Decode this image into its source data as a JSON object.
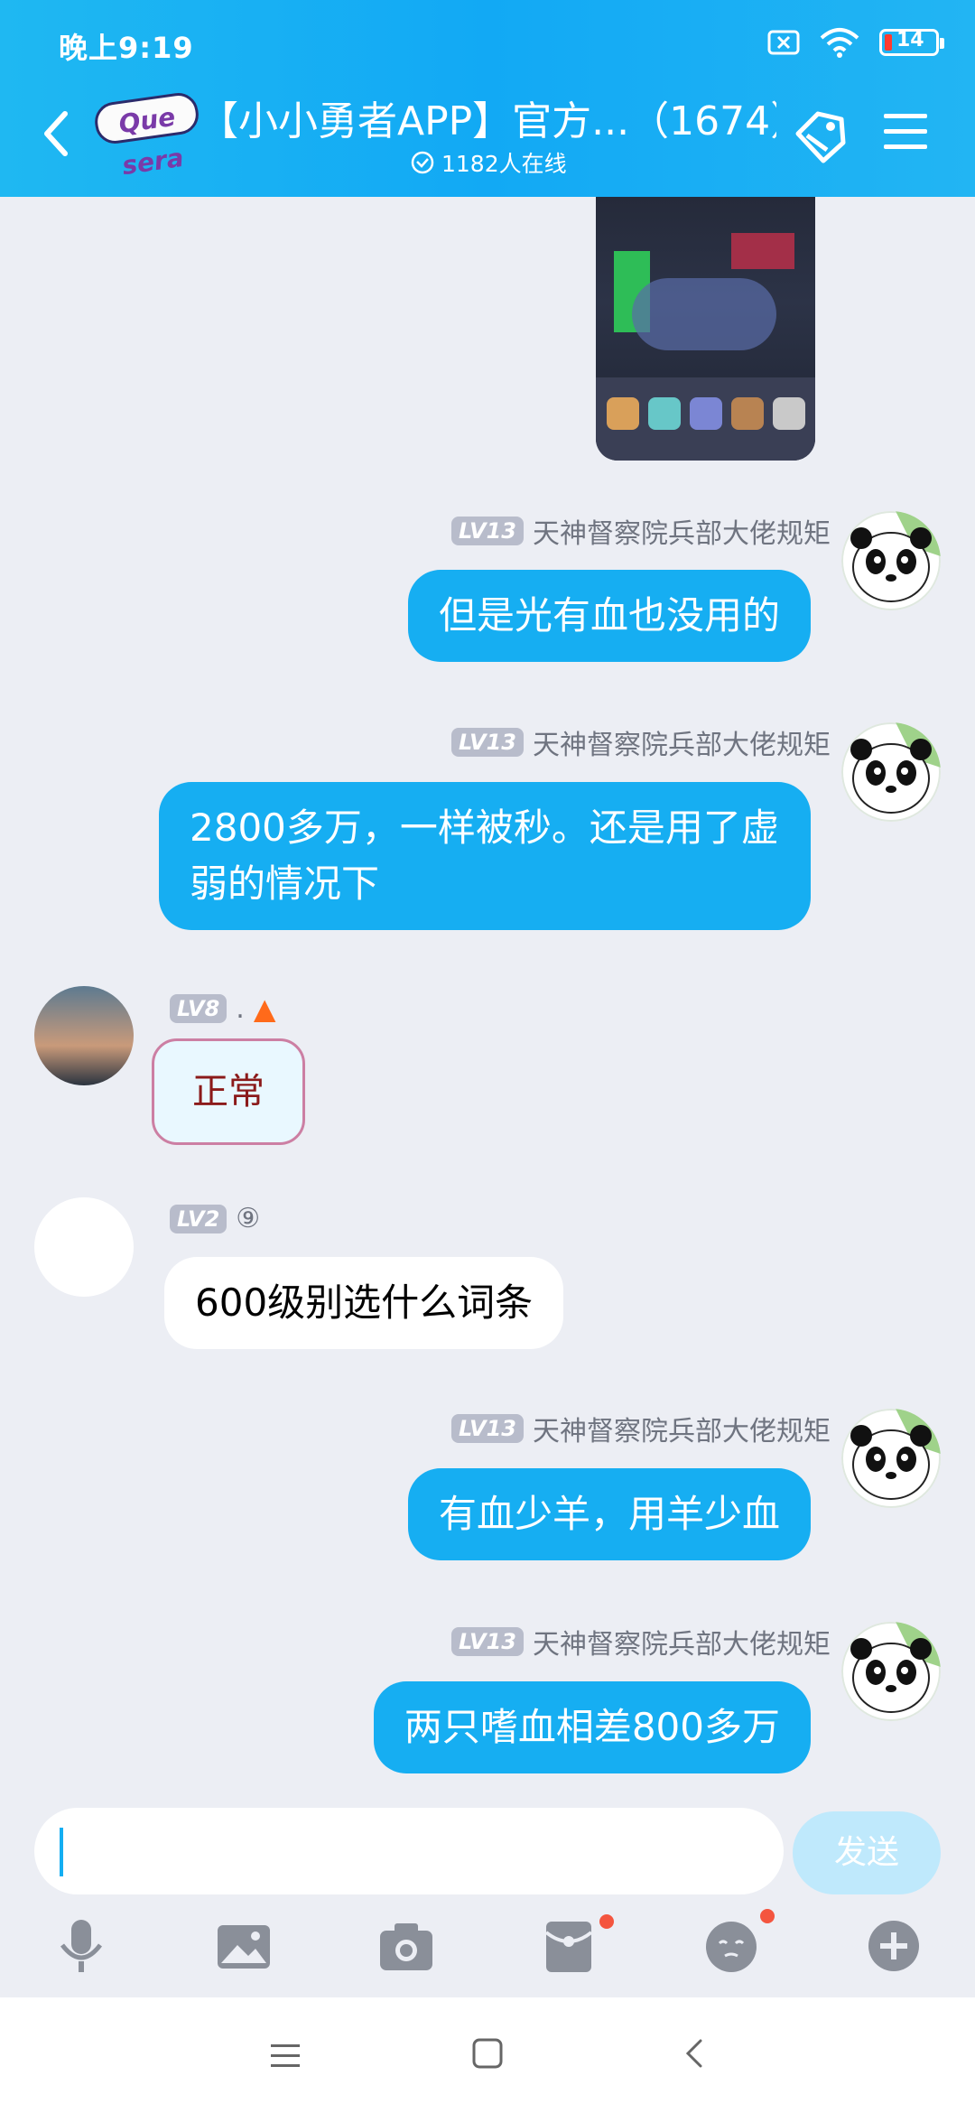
{
  "status": {
    "time": "晚上9:19",
    "battery": "14"
  },
  "header": {
    "logo_text": "Que sera",
    "title": "【小小勇者APP】官方...（1674）",
    "online": "1182人在线"
  },
  "messages": [
    {
      "kind": "image",
      "side": "right"
    },
    {
      "side": "right",
      "level": "LV13",
      "name": "天神督察院兵部大佬规矩",
      "text": "但是光有血也没用的"
    },
    {
      "side": "right",
      "level": "LV13",
      "name": "天神督察院兵部大佬规矩",
      "text": "2800多万，一样被秒。还是用了虚弱的情况下"
    },
    {
      "side": "left",
      "level": "LV8",
      "name": ".",
      "text": "正常",
      "kind": "sticker"
    },
    {
      "side": "left",
      "level": "LV2",
      "name": "⑨",
      "text": "600级别选什么词条"
    },
    {
      "side": "right",
      "level": "LV13",
      "name": "天神督察院兵部大佬规矩",
      "text": "有血少羊，用羊少血"
    },
    {
      "side": "right",
      "level": "LV13",
      "name": "天神督察院兵部大佬规矩",
      "text": "两只嗜血相差800多万"
    }
  ],
  "input": {
    "send_label": "发送"
  },
  "toolbar": [
    "mic-icon",
    "image-icon",
    "camera-icon",
    "red-packet-icon",
    "emoji-icon",
    "plus-icon"
  ],
  "colors": {
    "accent": "#16aef2",
    "send_disabled": "#bfe9fc",
    "badge": "#f4553f"
  }
}
